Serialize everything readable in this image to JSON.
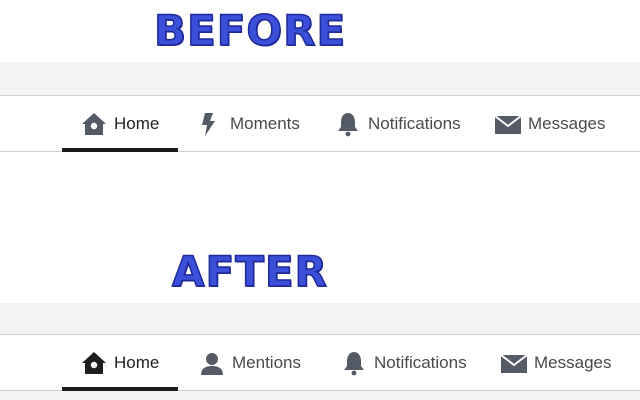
{
  "accent_color": "#3b4fd8",
  "accent_dark": "#1f2a9a",
  "before": {
    "heading": "BEFORE",
    "nav": [
      {
        "icon": "home-icon",
        "label": "Home",
        "active": true
      },
      {
        "icon": "lightning-icon",
        "label": "Moments",
        "active": false
      },
      {
        "icon": "bell-icon",
        "label": "Notifications",
        "active": false
      },
      {
        "icon": "envelope-icon",
        "label": "Messages",
        "active": false
      }
    ]
  },
  "after": {
    "heading": "AFTER",
    "nav": [
      {
        "icon": "home-icon",
        "label": "Home",
        "active": true
      },
      {
        "icon": "person-icon",
        "label": "Mentions",
        "active": false
      },
      {
        "icon": "bell-icon",
        "label": "Notifications",
        "active": false
      },
      {
        "icon": "envelope-icon",
        "label": "Messages",
        "active": false
      }
    ]
  }
}
